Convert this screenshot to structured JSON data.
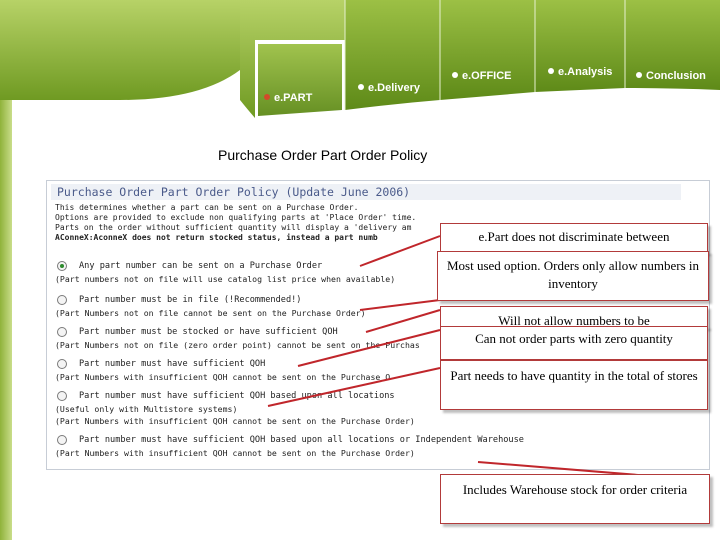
{
  "tabs": [
    {
      "label": "e.PART",
      "active": true
    },
    {
      "label": "e.Delivery",
      "active": false
    },
    {
      "label": "e.OFFICE",
      "active": false
    },
    {
      "label": "e.Analysis",
      "active": false
    },
    {
      "label": "Conclusion",
      "active": false
    }
  ],
  "page_title": "Purchase Order Part Order Policy",
  "policy": {
    "heading": "Purchase Order Part Order Policy (Update June 2006)",
    "desc": [
      "This determines whether a part can be sent on a Purchase Order.",
      "Options are provided to exclude non qualifying parts at 'Place Order' time.",
      "Parts on the order without sufficient quantity will display a 'delivery am",
      "AConneX:AconneX does not return stocked status, instead a part numb"
    ],
    "options": [
      {
        "label": "Any part number can be sent on a Purchase Order",
        "note": "(Part numbers not on file will use catalog list price when available)",
        "selected": true
      },
      {
        "label": "Part number must be in file (!Recommended!)",
        "note": "(Part Numbers not on file cannot be sent on the Purchase Order)",
        "selected": false
      },
      {
        "label": "Part number must be stocked or have sufficient QOH",
        "note": "(Part Numbers not on file (zero order point) cannot be sent on the Purchas",
        "selected": false
      },
      {
        "label": "Part number must have sufficient QOH",
        "note": "(Part Numbers with insufficient QOH cannot be sent on the Purchase O",
        "selected": false
      },
      {
        "label": "Part number must have sufficient QOH based upon all locations",
        "note": "(Useful only with Multistore systems)",
        "note2": "(Part Numbers with insufficient QOH cannot be sent on the Purchase Order)",
        "selected": false
      },
      {
        "label": "Part number must have sufficient QOH based upon all locations or Independent Warehouse",
        "note": "(Part Numbers with insufficient QOH cannot be sent on the Purchase Order)",
        "selected": false
      }
    ]
  },
  "callouts": {
    "c1": "e.Part does not discriminate between",
    "c2": "Most used option. Orders only allow numbers in inventory",
    "c3": "Will not allow numbers to be",
    "c4": "Can not order parts with zero quantity",
    "c5": "Part needs to have quantity in the total of stores",
    "c6": "Includes Warehouse stock for order criteria"
  },
  "colors": {
    "header_green": "#8db33a",
    "callout_border": "#b23a3a",
    "pointer_line": "#c0262b"
  }
}
